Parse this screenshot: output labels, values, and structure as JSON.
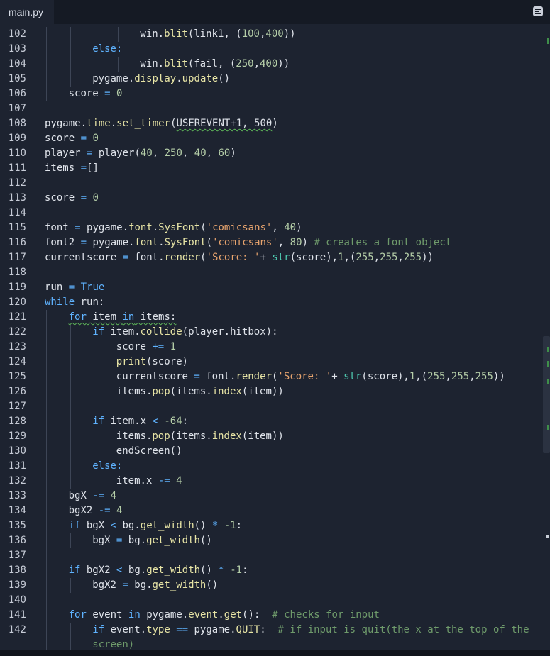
{
  "tab": {
    "label": "main.py"
  },
  "menu": {
    "icon": "list-menu-icon"
  },
  "colors": {
    "background": "#1d2330",
    "keyword": "#5fb3ff",
    "function": "#e8e5a6",
    "number": "#b5cea8",
    "string": "#e8a46e",
    "comment": "#6f9b6b",
    "builtin": "#4ec9b0",
    "lint_underline": "#5fb85a"
  },
  "lines": [
    {
      "n": "102",
      "indent": 2,
      "tokens": [
        [
          "win.",
          ""
        ],
        [
          "blit",
          "fn"
        ],
        [
          "(link1, (",
          ""
        ],
        [
          "100",
          "num"
        ],
        [
          ",",
          ""
        ],
        [
          "400",
          "num"
        ],
        [
          "))",
          ""
        ]
      ]
    },
    {
      "n": "103",
      "indent": 1,
      "tokens": [
        [
          "else:",
          "kw"
        ]
      ]
    },
    {
      "n": "104",
      "indent": 2,
      "tokens": [
        [
          "win.",
          ""
        ],
        [
          "blit",
          "fn"
        ],
        [
          "(fail, (",
          ""
        ],
        [
          "250",
          "num"
        ],
        [
          ",",
          ""
        ],
        [
          "400",
          "num"
        ],
        [
          "))",
          ""
        ]
      ]
    },
    {
      "n": "105",
      "indent": 1,
      "tokens": [
        [
          "pygame.",
          ""
        ],
        [
          "display",
          "fn"
        ],
        [
          ".",
          ""
        ],
        [
          "update",
          "fn"
        ],
        [
          "()",
          ""
        ]
      ]
    },
    {
      "n": "106",
      "indent": 0.5,
      "tokens": [
        [
          "score ",
          ""
        ],
        [
          "=",
          "op"
        ],
        [
          " ",
          ""
        ],
        [
          "0",
          "num"
        ]
      ]
    },
    {
      "n": "107",
      "indent": 0,
      "tokens": []
    },
    {
      "n": "108",
      "indent": 0,
      "tokens": [
        [
          "pygame.",
          ""
        ],
        [
          "time",
          "fn"
        ],
        [
          ".",
          ""
        ],
        [
          "set_timer",
          "fn"
        ],
        [
          "(",
          ""
        ],
        [
          "USEREVENT+1, 500",
          "squig"
        ],
        [
          ")",
          ""
        ]
      ]
    },
    {
      "n": "109",
      "indent": 0,
      "tokens": [
        [
          "score ",
          ""
        ],
        [
          "=",
          "op"
        ],
        [
          " ",
          ""
        ],
        [
          "0",
          "num"
        ]
      ]
    },
    {
      "n": "110",
      "indent": 0,
      "tokens": [
        [
          "player ",
          ""
        ],
        [
          "=",
          "op"
        ],
        [
          " player(",
          ""
        ],
        [
          "40",
          "num"
        ],
        [
          ", ",
          ""
        ],
        [
          "250",
          "num"
        ],
        [
          ", ",
          ""
        ],
        [
          "40",
          "num"
        ],
        [
          ", ",
          ""
        ],
        [
          "60",
          "num"
        ],
        [
          ")",
          ""
        ]
      ]
    },
    {
      "n": "111",
      "indent": 0,
      "tokens": [
        [
          "items ",
          ""
        ],
        [
          "=",
          "op"
        ],
        [
          "[]",
          ""
        ]
      ]
    },
    {
      "n": "112",
      "indent": 0,
      "tokens": []
    },
    {
      "n": "113",
      "indent": 0,
      "tokens": [
        [
          "score ",
          ""
        ],
        [
          "=",
          "op"
        ],
        [
          " ",
          ""
        ],
        [
          "0",
          "num"
        ]
      ]
    },
    {
      "n": "114",
      "indent": 0,
      "tokens": []
    },
    {
      "n": "115",
      "indent": 0,
      "tokens": [
        [
          "font ",
          ""
        ],
        [
          "=",
          "op"
        ],
        [
          " pygame.",
          ""
        ],
        [
          "font",
          "fn"
        ],
        [
          ".",
          ""
        ],
        [
          "SysFont",
          "fn"
        ],
        [
          "(",
          ""
        ],
        [
          "'comicsans'",
          "str"
        ],
        [
          ", ",
          ""
        ],
        [
          "40",
          "num"
        ],
        [
          ")",
          ""
        ]
      ]
    },
    {
      "n": "116",
      "indent": 0,
      "tokens": [
        [
          "font2 ",
          ""
        ],
        [
          "=",
          "op"
        ],
        [
          " pygame.",
          ""
        ],
        [
          "font",
          "fn"
        ],
        [
          ".",
          ""
        ],
        [
          "SysFont",
          "fn"
        ],
        [
          "(",
          ""
        ],
        [
          "'comicsans'",
          "str"
        ],
        [
          ", ",
          ""
        ],
        [
          "80",
          "num"
        ],
        [
          ") ",
          ""
        ],
        [
          "# creates a font object",
          "cm"
        ]
      ]
    },
    {
      "n": "117",
      "indent": 0,
      "tokens": [
        [
          "currentscore ",
          ""
        ],
        [
          "=",
          "op"
        ],
        [
          " font.",
          ""
        ],
        [
          "render",
          "fn"
        ],
        [
          "(",
          ""
        ],
        [
          "'Score: '",
          "str"
        ],
        [
          "+ ",
          ""
        ],
        [
          "str",
          "bi"
        ],
        [
          "(score),",
          ""
        ],
        [
          "1",
          "num"
        ],
        [
          ",(",
          ""
        ],
        [
          "255",
          "num"
        ],
        [
          ",",
          ""
        ],
        [
          "255",
          "num"
        ],
        [
          ",",
          ""
        ],
        [
          "255",
          "num"
        ],
        [
          "))",
          ""
        ]
      ]
    },
    {
      "n": "118",
      "indent": 0,
      "tokens": []
    },
    {
      "n": "119",
      "indent": 0,
      "tokens": [
        [
          "run ",
          ""
        ],
        [
          "=",
          "op"
        ],
        [
          " ",
          ""
        ],
        [
          "True",
          "kw"
        ]
      ]
    },
    {
      "n": "120",
      "indent": 0,
      "tokens": [
        [
          "while",
          "kw"
        ],
        [
          " run:",
          ""
        ]
      ]
    },
    {
      "n": "121",
      "indent": 0.5,
      "squig_full": true,
      "tokens": [
        [
          "for",
          "kw"
        ],
        [
          " item ",
          ""
        ],
        [
          "in",
          "kw"
        ],
        [
          " items:",
          ""
        ]
      ]
    },
    {
      "n": "122",
      "indent": 1,
      "tokens": [
        [
          "if",
          "kw"
        ],
        [
          " item.",
          ""
        ],
        [
          "collide",
          "fn"
        ],
        [
          "(player.hitbox):",
          ""
        ]
      ]
    },
    {
      "n": "123",
      "indent": 1.5,
      "tokens": [
        [
          "score ",
          ""
        ],
        [
          "+=",
          "op"
        ],
        [
          " ",
          ""
        ],
        [
          "1",
          "num"
        ]
      ]
    },
    {
      "n": "124",
      "indent": 1.5,
      "tokens": [
        [
          "print",
          "fn"
        ],
        [
          "(score)",
          ""
        ]
      ]
    },
    {
      "n": "125",
      "indent": 1.5,
      "tokens": [
        [
          "currentscore ",
          ""
        ],
        [
          "=",
          "op"
        ],
        [
          " font.",
          ""
        ],
        [
          "render",
          "fn"
        ],
        [
          "(",
          ""
        ],
        [
          "'Score: '",
          "str"
        ],
        [
          "+ ",
          ""
        ],
        [
          "str",
          "bi"
        ],
        [
          "(score),",
          ""
        ],
        [
          "1",
          "num"
        ],
        [
          ",(",
          ""
        ],
        [
          "255",
          "num"
        ],
        [
          ",",
          ""
        ],
        [
          "255",
          "num"
        ],
        [
          ",",
          ""
        ],
        [
          "255",
          "num"
        ],
        [
          "))",
          ""
        ]
      ]
    },
    {
      "n": "126",
      "indent": 1.5,
      "tokens": [
        [
          "items.",
          ""
        ],
        [
          "pop",
          "fn"
        ],
        [
          "(items.",
          ""
        ],
        [
          "index",
          "fn"
        ],
        [
          "(item))",
          ""
        ]
      ]
    },
    {
      "n": "127",
      "indent": 1.5,
      "tokens": []
    },
    {
      "n": "128",
      "indent": 1,
      "tokens": [
        [
          "if",
          "kw"
        ],
        [
          " item.x ",
          ""
        ],
        [
          "<",
          "op"
        ],
        [
          " ",
          ""
        ],
        [
          "-64",
          "num"
        ],
        [
          ":",
          ""
        ]
      ]
    },
    {
      "n": "129",
      "indent": 1.5,
      "tokens": [
        [
          "items.",
          ""
        ],
        [
          "pop",
          "fn"
        ],
        [
          "(items.",
          ""
        ],
        [
          "index",
          "fn"
        ],
        [
          "(item))",
          ""
        ]
      ]
    },
    {
      "n": "130",
      "indent": 1.5,
      "tokens": [
        [
          "endScreen()",
          ""
        ]
      ]
    },
    {
      "n": "131",
      "indent": 1,
      "tokens": [
        [
          "else:",
          "kw"
        ]
      ]
    },
    {
      "n": "132",
      "indent": 1.5,
      "tokens": [
        [
          "item.x ",
          ""
        ],
        [
          "-=",
          "op"
        ],
        [
          " ",
          ""
        ],
        [
          "4",
          "num"
        ]
      ]
    },
    {
      "n": "133",
      "indent": 0.5,
      "tokens": [
        [
          "bgX ",
          ""
        ],
        [
          "-=",
          "op"
        ],
        [
          " ",
          ""
        ],
        [
          "4",
          "num"
        ]
      ]
    },
    {
      "n": "134",
      "indent": 0.5,
      "tokens": [
        [
          "bgX2 ",
          ""
        ],
        [
          "-=",
          "op"
        ],
        [
          " ",
          ""
        ],
        [
          "4",
          "num"
        ]
      ]
    },
    {
      "n": "135",
      "indent": 0.5,
      "tokens": [
        [
          "if",
          "kw"
        ],
        [
          " bgX ",
          ""
        ],
        [
          "<",
          "op"
        ],
        [
          " bg.",
          ""
        ],
        [
          "get_width",
          "fn"
        ],
        [
          "() ",
          ""
        ],
        [
          "*",
          "op"
        ],
        [
          " ",
          ""
        ],
        [
          "-1",
          "num"
        ],
        [
          ":",
          ""
        ]
      ]
    },
    {
      "n": "136",
      "indent": 1,
      "tokens": [
        [
          "bgX ",
          ""
        ],
        [
          "=",
          "op"
        ],
        [
          " bg.",
          ""
        ],
        [
          "get_width",
          "fn"
        ],
        [
          "()",
          ""
        ]
      ]
    },
    {
      "n": "137",
      "indent": 0.5,
      "tokens": []
    },
    {
      "n": "138",
      "indent": 0.5,
      "tokens": [
        [
          "if",
          "kw"
        ],
        [
          " bgX2 ",
          ""
        ],
        [
          "<",
          "op"
        ],
        [
          " bg.",
          ""
        ],
        [
          "get_width",
          "fn"
        ],
        [
          "() ",
          ""
        ],
        [
          "*",
          "op"
        ],
        [
          " ",
          ""
        ],
        [
          "-1",
          "num"
        ],
        [
          ":",
          ""
        ]
      ]
    },
    {
      "n": "139",
      "indent": 1,
      "tokens": [
        [
          "bgX2 ",
          ""
        ],
        [
          "=",
          "op"
        ],
        [
          " bg.",
          ""
        ],
        [
          "get_width",
          "fn"
        ],
        [
          "()",
          ""
        ]
      ]
    },
    {
      "n": "140",
      "indent": 0.5,
      "tokens": []
    },
    {
      "n": "141",
      "indent": 0.5,
      "tokens": [
        [
          "for",
          "kw"
        ],
        [
          " event ",
          ""
        ],
        [
          "in",
          "kw"
        ],
        [
          " pygame.",
          ""
        ],
        [
          "event",
          "fn"
        ],
        [
          ".",
          ""
        ],
        [
          "get",
          "fn"
        ],
        [
          "():  ",
          ""
        ],
        [
          "# checks for input",
          "cm"
        ]
      ]
    },
    {
      "n": "142",
      "indent": 1,
      "tokens": [
        [
          "if",
          "kw"
        ],
        [
          " event.",
          ""
        ],
        [
          "type",
          "fn"
        ],
        [
          " ",
          ""
        ],
        [
          "==",
          "op"
        ],
        [
          " pygame.",
          ""
        ],
        [
          "QUIT",
          "fn"
        ],
        [
          ":  ",
          ""
        ],
        [
          "# if input is quit(the x at the top of the",
          "cm"
        ]
      ]
    },
    {
      "n": "",
      "indent": 1,
      "tokens": [
        [
          "screen)",
          "cm"
        ]
      ]
    }
  ]
}
